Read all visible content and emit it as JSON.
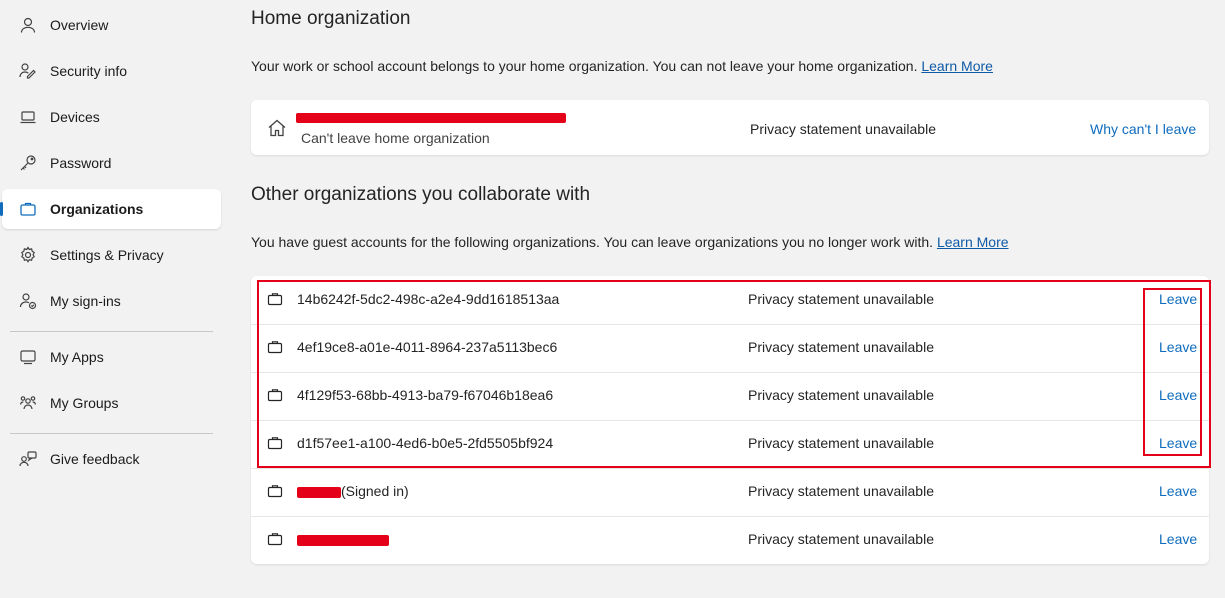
{
  "sidebar": {
    "items": [
      {
        "label": "Overview",
        "icon": "person-icon"
      },
      {
        "label": "Security info",
        "icon": "security-info-icon"
      },
      {
        "label": "Devices",
        "icon": "laptop-icon"
      },
      {
        "label": "Password",
        "icon": "key-icon"
      },
      {
        "label": "Organizations",
        "icon": "briefcase-icon",
        "active": true
      },
      {
        "label": "Settings & Privacy",
        "icon": "gear-icon"
      },
      {
        "label": "My sign-ins",
        "icon": "sign-ins-icon"
      },
      {
        "label": "My Apps",
        "icon": "apps-icon"
      },
      {
        "label": "My Groups",
        "icon": "groups-icon"
      },
      {
        "label": "Give feedback",
        "icon": "feedback-icon"
      }
    ]
  },
  "home": {
    "title": "Home organization",
    "description": "Your work or school account belongs to your home organization. You can not leave your home organization.",
    "learn_more": "Learn More",
    "card": {
      "subtitle": "Can't leave home organization",
      "privacy": "Privacy statement unavailable",
      "action": "Why can't I leave"
    }
  },
  "other": {
    "title": "Other organizations you collaborate with",
    "description": "You have guest accounts for the following organizations. You can leave organizations you no longer work with.",
    "learn_more": "Learn More",
    "organizations": [
      {
        "name": "14b6242f-5dc2-498c-a2e4-9dd1618513aa",
        "privacy": "Privacy statement unavailable",
        "action": "Leave"
      },
      {
        "name": "4ef19ce8-a01e-4011-8964-237a5113bec6",
        "privacy": "Privacy statement unavailable",
        "action": "Leave"
      },
      {
        "name": "4f129f53-68bb-4913-ba79-f67046b18ea6",
        "privacy": "Privacy statement unavailable",
        "action": "Leave"
      },
      {
        "name": "d1f57ee1-a100-4ed6-b0e5-2fd5505bf924",
        "privacy": "Privacy statement unavailable",
        "action": "Leave"
      },
      {
        "name_suffix": "(Signed in)",
        "privacy": "Privacy statement unavailable",
        "action": "Leave"
      },
      {
        "privacy": "Privacy statement unavailable",
        "action": "Leave"
      }
    ]
  },
  "colors": {
    "accent": "#0f6cbd",
    "link": "#0f5aa6",
    "annotation": "#e5001a",
    "background": "#f2f2f2"
  }
}
